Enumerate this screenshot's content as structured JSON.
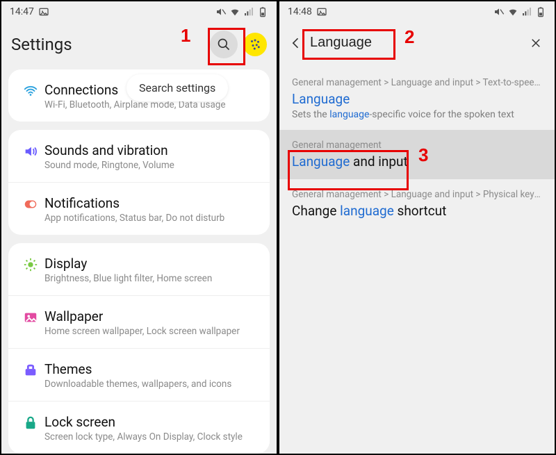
{
  "left": {
    "status": {
      "time": "14:47"
    },
    "header": {
      "title": "Settings"
    },
    "tooltip": "Search settings",
    "groups": [
      {
        "items": [
          {
            "icon": "wifi",
            "title": "Connections",
            "sub": "Wi-Fi, Bluetooth, Airplane mode, Data usage"
          }
        ]
      },
      {
        "items": [
          {
            "icon": "sound",
            "title": "Sounds and vibration",
            "sub": "Sound mode, Ringtone, Volume"
          },
          {
            "icon": "notif",
            "title": "Notifications",
            "sub": "App notifications, Status bar, Do not disturb"
          }
        ]
      },
      {
        "items": [
          {
            "icon": "display",
            "title": "Display",
            "sub": "Brightness, Blue light filter, Home screen"
          },
          {
            "icon": "wallpaper",
            "title": "Wallpaper",
            "sub": "Home screen wallpaper, Lock screen wallpaper"
          },
          {
            "icon": "themes",
            "title": "Themes",
            "sub": "Downloadable themes, wallpapers, and icons"
          },
          {
            "icon": "lock",
            "title": "Lock screen",
            "sub": "Screen lock type, Always On Display, Clock style"
          }
        ]
      }
    ]
  },
  "right": {
    "status": {
      "time": "14:48"
    },
    "search": {
      "value": "Language"
    },
    "results": [
      {
        "crumb": "General management > Language and input > Text-to-speech",
        "title_pre": "",
        "title_hl": "Language",
        "title_post": "",
        "title_blue": true,
        "desc_pre": "Sets the ",
        "desc_hl": "language",
        "desc_post": "-specific voice for the spoken text",
        "selected": false
      },
      {
        "crumb": "General management",
        "title_pre": "",
        "title_hl": "Language",
        "title_post": " and input",
        "title_blue": false,
        "desc_pre": "",
        "desc_hl": "",
        "desc_post": "",
        "selected": true
      },
      {
        "crumb": "General management > Language and input > Physical keybo…",
        "title_pre": "Change ",
        "title_hl": "language",
        "title_post": " shortcut",
        "title_blue": false,
        "desc_pre": "",
        "desc_hl": "",
        "desc_post": "",
        "selected": false
      }
    ]
  },
  "annotations": {
    "n1": "1",
    "n2": "2",
    "n3": "3"
  }
}
